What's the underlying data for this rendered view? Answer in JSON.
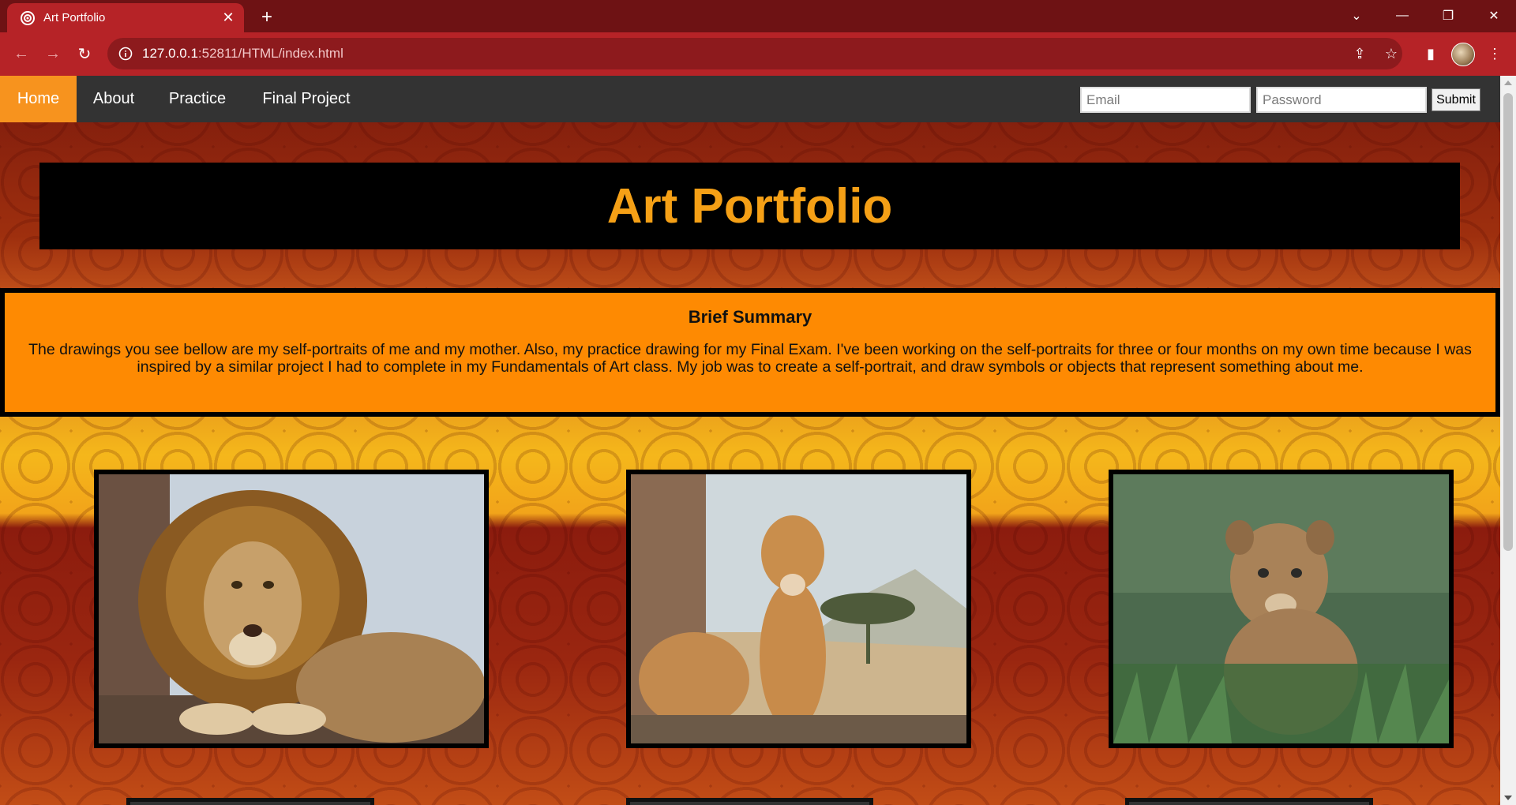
{
  "browser": {
    "tab_title": "Art Portfolio",
    "url_host": "127.0.0.1",
    "url_rest": ":52811/HTML/index.html"
  },
  "nav": {
    "links": [
      "Home",
      "About",
      "Practice",
      "Final Project"
    ],
    "active": "Home",
    "email_placeholder": "Email",
    "password_placeholder": "Password",
    "submit_label": "Submit"
  },
  "header": {
    "title": "Art Portfolio"
  },
  "summary": {
    "heading": "Brief Summary",
    "text": "The drawings you see bellow are my self-portraits of me and my mother. Also, my practice drawing for my Final Exam. I've been working on the self-portraits for three or four months on my own time because I was inspired by a similar project I had to complete in my Fundamentals of Art class. My job was to create a self-portrait, and draw symbols or objects that represent something about me."
  },
  "gallery": [
    {
      "subject": "lion"
    },
    {
      "subject": "lioness"
    },
    {
      "subject": "lion-cub"
    }
  ],
  "colors": {
    "accent": "#f7931e",
    "title": "#f5a016",
    "summary_bg": "#fe8a02",
    "nav_bg": "#333333",
    "chrome": "#b62327"
  }
}
